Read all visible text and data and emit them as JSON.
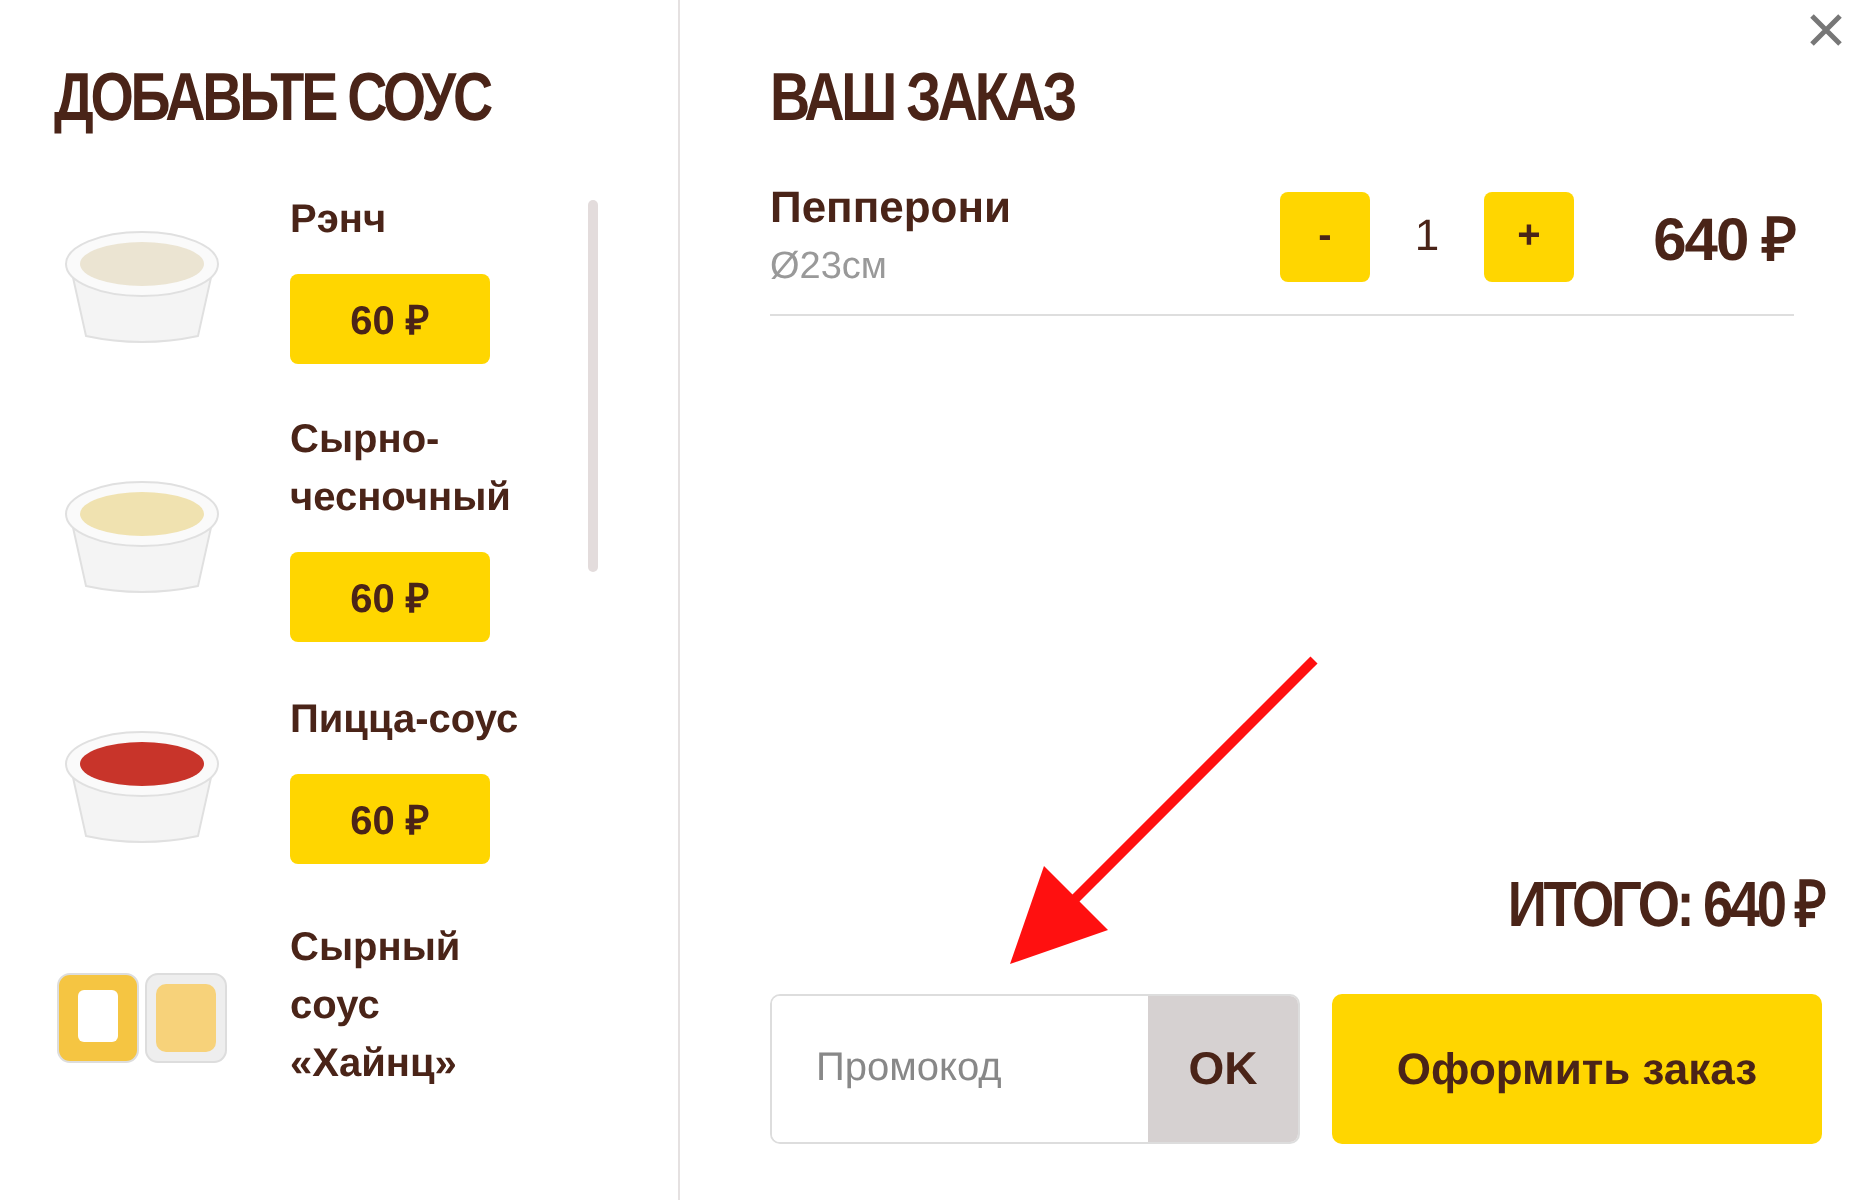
{
  "sauces": {
    "title": "ДОБАВЬТЕ СОУС",
    "items": [
      {
        "name": "Рэнч",
        "price": "60 ₽",
        "kind": "bowl",
        "color": "#ebe4d2"
      },
      {
        "name": "Сырно-чесночный",
        "price": "60 ₽",
        "kind": "bowl",
        "color": "#f0e2b0"
      },
      {
        "name": "Пицца-соус",
        "price": "60 ₽",
        "kind": "bowl",
        "color": "#c8342a"
      },
      {
        "name": "Сырный соус «Хайнц»",
        "kind": "packets",
        "color": "#f5c542"
      }
    ]
  },
  "order": {
    "title": "ВАШ ЗАКАЗ",
    "items": [
      {
        "name": "Пепперони",
        "size": "Ø23см",
        "minus": "-",
        "quantity": "1",
        "plus": "+",
        "price": "640 ₽"
      }
    ],
    "total": "ИТОГО: 640 ₽",
    "promo": {
      "placeholder": "Промокод",
      "button": "OK"
    },
    "checkout": "Оформить заказ"
  }
}
